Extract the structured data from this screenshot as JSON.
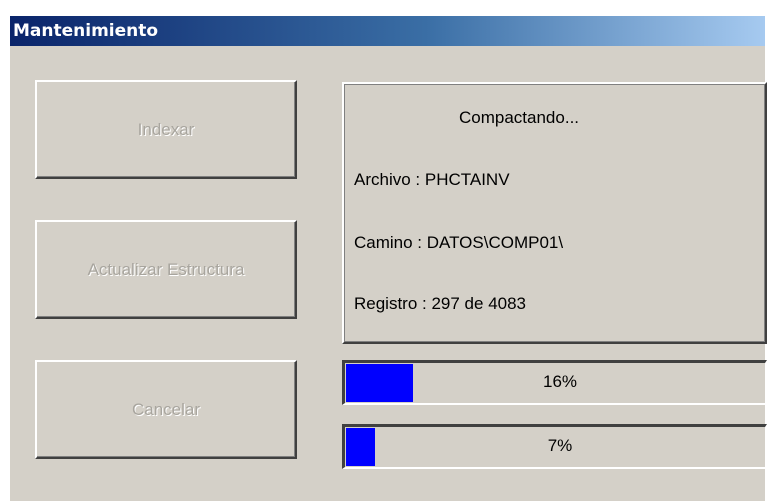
{
  "window": {
    "title": "Mantenimiento"
  },
  "buttons": {
    "indexar": "Indexar",
    "actualizar": "Actualizar Estructura",
    "cancelar": "Cancelar"
  },
  "status": {
    "heading": "Compactando...",
    "archivo": "Archivo : PHCTAINV",
    "camino": "Camino : DATOS\\COMP01\\",
    "registro": "Registro : 297 de 4083"
  },
  "progress": [
    {
      "label": "16%",
      "value": 0.16
    },
    {
      "label": "7%",
      "value": 0.07
    }
  ],
  "colors": {
    "title_gradient_start": "#0a246a",
    "title_gradient_end": "#a6caf0",
    "progress_fill": "#0000ff",
    "window_bg": "#d4d0c8"
  }
}
